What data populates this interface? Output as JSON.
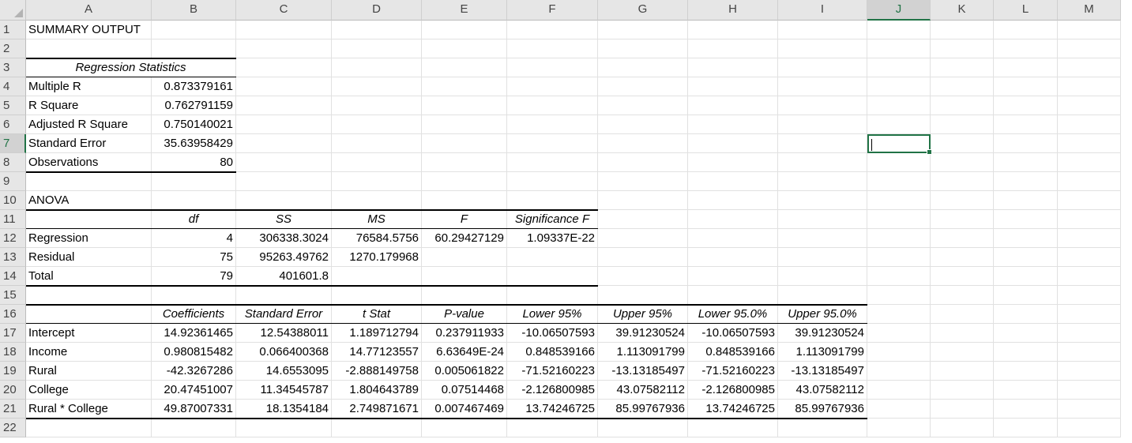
{
  "columns": [
    "A",
    "B",
    "C",
    "D",
    "E",
    "F",
    "G",
    "H",
    "I",
    "J",
    "K",
    "L",
    "M"
  ],
  "active_column": "J",
  "active_row": 7,
  "active_cell": "J7",
  "rows": [
    {
      "n": 1,
      "cells": [
        {
          "c": "A",
          "v": "SUMMARY OUTPUT"
        }
      ]
    },
    {
      "n": 2,
      "cells": []
    },
    {
      "n": 3,
      "cells": [
        {
          "c": "A",
          "v": "Regression Statistics",
          "style": "center ital",
          "span": 2
        }
      ]
    },
    {
      "n": 4,
      "cells": [
        {
          "c": "A",
          "v": "Multiple R"
        },
        {
          "c": "B",
          "v": "0.873379161",
          "style": "num"
        }
      ]
    },
    {
      "n": 5,
      "cells": [
        {
          "c": "A",
          "v": "R Square"
        },
        {
          "c": "B",
          "v": "0.762791159",
          "style": "num"
        }
      ]
    },
    {
      "n": 6,
      "cells": [
        {
          "c": "A",
          "v": "Adjusted R Square"
        },
        {
          "c": "B",
          "v": "0.750140021",
          "style": "num"
        }
      ]
    },
    {
      "n": 7,
      "cells": [
        {
          "c": "A",
          "v": "Standard Error"
        },
        {
          "c": "B",
          "v": "35.63958429",
          "style": "num"
        }
      ]
    },
    {
      "n": 8,
      "cells": [
        {
          "c": "A",
          "v": "Observations"
        },
        {
          "c": "B",
          "v": "80",
          "style": "num"
        }
      ]
    },
    {
      "n": 9,
      "cells": []
    },
    {
      "n": 10,
      "cells": [
        {
          "c": "A",
          "v": "ANOVA"
        }
      ]
    },
    {
      "n": 11,
      "cells": [
        {
          "c": "B",
          "v": "df",
          "style": "center ital"
        },
        {
          "c": "C",
          "v": "SS",
          "style": "center ital"
        },
        {
          "c": "D",
          "v": "MS",
          "style": "center ital"
        },
        {
          "c": "E",
          "v": "F",
          "style": "center ital"
        },
        {
          "c": "F",
          "v": "Significance F",
          "style": "center ital"
        }
      ]
    },
    {
      "n": 12,
      "cells": [
        {
          "c": "A",
          "v": "Regression"
        },
        {
          "c": "B",
          "v": "4",
          "style": "num"
        },
        {
          "c": "C",
          "v": "306338.3024",
          "style": "num"
        },
        {
          "c": "D",
          "v": "76584.5756",
          "style": "num"
        },
        {
          "c": "E",
          "v": "60.29427129",
          "style": "num"
        },
        {
          "c": "F",
          "v": "1.09337E-22",
          "style": "num"
        }
      ]
    },
    {
      "n": 13,
      "cells": [
        {
          "c": "A",
          "v": "Residual"
        },
        {
          "c": "B",
          "v": "75",
          "style": "num"
        },
        {
          "c": "C",
          "v": "95263.49762",
          "style": "num"
        },
        {
          "c": "D",
          "v": "1270.179968",
          "style": "num"
        }
      ]
    },
    {
      "n": 14,
      "cells": [
        {
          "c": "A",
          "v": "Total"
        },
        {
          "c": "B",
          "v": "79",
          "style": "num"
        },
        {
          "c": "C",
          "v": "401601.8",
          "style": "num"
        }
      ]
    },
    {
      "n": 15,
      "cells": []
    },
    {
      "n": 16,
      "cells": [
        {
          "c": "B",
          "v": "Coefficients",
          "style": "center ital"
        },
        {
          "c": "C",
          "v": "Standard Error",
          "style": "center ital"
        },
        {
          "c": "D",
          "v": "t Stat",
          "style": "center ital"
        },
        {
          "c": "E",
          "v": "P-value",
          "style": "center ital"
        },
        {
          "c": "F",
          "v": "Lower 95%",
          "style": "center ital"
        },
        {
          "c": "G",
          "v": "Upper 95%",
          "style": "center ital"
        },
        {
          "c": "H",
          "v": "Lower 95.0%",
          "style": "center ital"
        },
        {
          "c": "I",
          "v": "Upper 95.0%",
          "style": "center ital"
        }
      ]
    },
    {
      "n": 17,
      "cells": [
        {
          "c": "A",
          "v": "Intercept"
        },
        {
          "c": "B",
          "v": "14.92361465",
          "style": "num"
        },
        {
          "c": "C",
          "v": "12.54388011",
          "style": "num"
        },
        {
          "c": "D",
          "v": "1.189712794",
          "style": "num"
        },
        {
          "c": "E",
          "v": "0.237911933",
          "style": "num"
        },
        {
          "c": "F",
          "v": "-10.06507593",
          "style": "num"
        },
        {
          "c": "G",
          "v": "39.91230524",
          "style": "num"
        },
        {
          "c": "H",
          "v": "-10.06507593",
          "style": "num"
        },
        {
          "c": "I",
          "v": "39.91230524",
          "style": "num"
        }
      ]
    },
    {
      "n": 18,
      "cells": [
        {
          "c": "A",
          "v": "Income"
        },
        {
          "c": "B",
          "v": "0.980815482",
          "style": "num"
        },
        {
          "c": "C",
          "v": "0.066400368",
          "style": "num"
        },
        {
          "c": "D",
          "v": "14.77123557",
          "style": "num"
        },
        {
          "c": "E",
          "v": "6.63649E-24",
          "style": "num"
        },
        {
          "c": "F",
          "v": "0.848539166",
          "style": "num"
        },
        {
          "c": "G",
          "v": "1.113091799",
          "style": "num"
        },
        {
          "c": "H",
          "v": "0.848539166",
          "style": "num"
        },
        {
          "c": "I",
          "v": "1.113091799",
          "style": "num"
        }
      ]
    },
    {
      "n": 19,
      "cells": [
        {
          "c": "A",
          "v": "Rural"
        },
        {
          "c": "B",
          "v": "-42.3267286",
          "style": "num"
        },
        {
          "c": "C",
          "v": "14.6553095",
          "style": "num"
        },
        {
          "c": "D",
          "v": "-2.888149758",
          "style": "num"
        },
        {
          "c": "E",
          "v": "0.005061822",
          "style": "num"
        },
        {
          "c": "F",
          "v": "-71.52160223",
          "style": "num"
        },
        {
          "c": "G",
          "v": "-13.13185497",
          "style": "num"
        },
        {
          "c": "H",
          "v": "-71.52160223",
          "style": "num"
        },
        {
          "c": "I",
          "v": "-13.13185497",
          "style": "num"
        }
      ]
    },
    {
      "n": 20,
      "cells": [
        {
          "c": "A",
          "v": "College"
        },
        {
          "c": "B",
          "v": "20.47451007",
          "style": "num"
        },
        {
          "c": "C",
          "v": "11.34545787",
          "style": "num"
        },
        {
          "c": "D",
          "v": "1.804643789",
          "style": "num"
        },
        {
          "c": "E",
          "v": "0.07514468",
          "style": "num"
        },
        {
          "c": "F",
          "v": "-2.126800985",
          "style": "num"
        },
        {
          "c": "G",
          "v": "43.07582112",
          "style": "num"
        },
        {
          "c": "H",
          "v": "-2.126800985",
          "style": "num"
        },
        {
          "c": "I",
          "v": "43.07582112",
          "style": "num"
        }
      ]
    },
    {
      "n": 21,
      "cells": [
        {
          "c": "A",
          "v": "Rural * College"
        },
        {
          "c": "B",
          "v": "49.87007331",
          "style": "num"
        },
        {
          "c": "C",
          "v": "18.1354184",
          "style": "num"
        },
        {
          "c": "D",
          "v": "2.749871671",
          "style": "num"
        },
        {
          "c": "E",
          "v": "0.007467469",
          "style": "num"
        },
        {
          "c": "F",
          "v": "13.74246725",
          "style": "num"
        },
        {
          "c": "G",
          "v": "85.99767936",
          "style": "num"
        },
        {
          "c": "H",
          "v": "13.74246725",
          "style": "num"
        },
        {
          "c": "I",
          "v": "85.99767936",
          "style": "num"
        }
      ]
    },
    {
      "n": 22,
      "cells": []
    }
  ],
  "borders": [
    {
      "row": 3,
      "from": "A",
      "to": "B",
      "edge": "top",
      "weight": "thick"
    },
    {
      "row": 3,
      "from": "A",
      "to": "B",
      "edge": "bottom",
      "weight": "thin"
    },
    {
      "row": 8,
      "from": "A",
      "to": "B",
      "edge": "bottom",
      "weight": "thick"
    },
    {
      "row": 11,
      "from": "A",
      "to": "F",
      "edge": "top",
      "weight": "thick"
    },
    {
      "row": 11,
      "from": "A",
      "to": "F",
      "edge": "bottom",
      "weight": "thin"
    },
    {
      "row": 14,
      "from": "A",
      "to": "F",
      "edge": "bottom",
      "weight": "thick"
    },
    {
      "row": 16,
      "from": "A",
      "to": "I",
      "edge": "top",
      "weight": "thick"
    },
    {
      "row": 16,
      "from": "A",
      "to": "I",
      "edge": "bottom",
      "weight": "thin"
    },
    {
      "row": 21,
      "from": "A",
      "to": "I",
      "edge": "bottom",
      "weight": "thick"
    }
  ]
}
